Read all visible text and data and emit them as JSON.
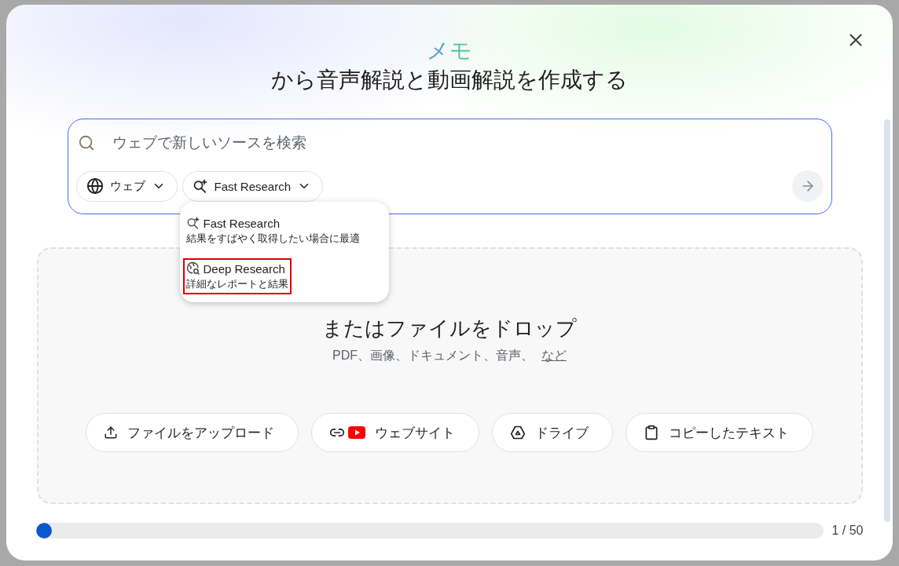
{
  "header": {
    "badge": "メモ",
    "title": "から音声解説と動画解説を作成する"
  },
  "search": {
    "placeholder": "ウェブで新しいソースを検索",
    "chips": [
      {
        "kind": "globe",
        "label": "ウェブ"
      },
      {
        "kind": "sparkle",
        "label": "Fast Research"
      }
    ]
  },
  "research_menu": {
    "open": true,
    "items": [
      {
        "kind": "sparkle",
        "label": "Fast Research",
        "description": "結果をすばやく取得したい場合に最適",
        "highlighted": false
      },
      {
        "kind": "deep",
        "label": "Deep Research",
        "description": "詳細なレポートと結果",
        "highlighted": true
      }
    ]
  },
  "dropzone": {
    "title": "またはファイルをドロップ",
    "subtitle": "PDF、画像、ドキュメント、音声、",
    "link": "など",
    "buttons": [
      {
        "kind": "upload",
        "label": "ファイルをアップロード"
      },
      {
        "kind": "website",
        "label": "ウェブサイト"
      },
      {
        "kind": "drive",
        "label": "ドライブ"
      },
      {
        "kind": "paste",
        "label": "コピーしたテキスト"
      }
    ]
  },
  "source_limit": {
    "level": 0.02,
    "reading": "1 / 50"
  }
}
